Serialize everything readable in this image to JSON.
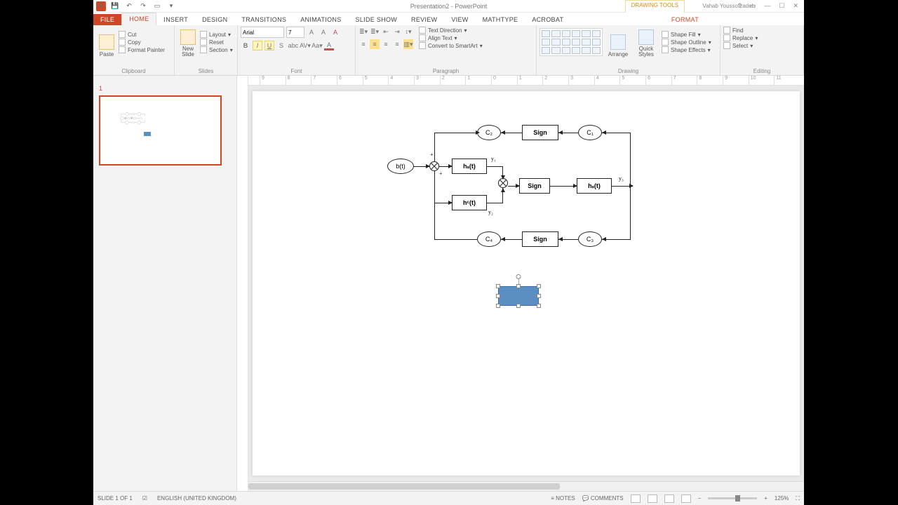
{
  "title": "Presentation2 - PowerPoint",
  "tools_context": "DRAWING TOOLS",
  "user": "Vahab Youssofzadeh",
  "tabs": {
    "file": "FILE",
    "home": "HOME",
    "insert": "INSERT",
    "design": "DESIGN",
    "transitions": "TRANSITIONS",
    "animations": "ANIMATIONS",
    "slideshow": "SLIDE SHOW",
    "review": "REVIEW",
    "view": "VIEW",
    "mathtype": "MathType",
    "acrobat": "ACROBAT",
    "format": "FORMAT"
  },
  "ribbon": {
    "clipboard": {
      "label": "Clipboard",
      "paste": "Paste",
      "cut": "Cut",
      "copy": "Copy",
      "painter": "Format Painter"
    },
    "slides": {
      "label": "Slides",
      "new": "New\nSlide",
      "layout": "Layout",
      "reset": "Reset",
      "section": "Section"
    },
    "font": {
      "label": "Font",
      "name": "Arial",
      "size": "7"
    },
    "paragraph": {
      "label": "Paragraph",
      "textdir": "Text Direction",
      "align": "Align Text",
      "convert": "Convert to SmartArt"
    },
    "drawing": {
      "label": "Drawing",
      "arrange": "Arrange",
      "quick": "Quick\nStyles",
      "fill": "Shape Fill",
      "outline": "Shape Outline",
      "effects": "Shape Effects"
    },
    "editing": {
      "label": "Editing",
      "find": "Find",
      "replace": "Replace",
      "select": "Select"
    }
  },
  "ruler": [
    "9",
    "8",
    "7",
    "6",
    "5",
    "4",
    "3",
    "2",
    "1",
    "0",
    "1",
    "2",
    "3",
    "4",
    "5",
    "6",
    "7",
    "8",
    "9",
    "10",
    "11"
  ],
  "diagram": {
    "C1": "C₁",
    "C2": "C₂",
    "C3": "C₃",
    "C4": "C₄",
    "Sign": "Sign",
    "bt": "b(t)",
    "hs": "hₛ(t)",
    "hc": "hᶜ(t)",
    "hs2": "hₛ(t)",
    "y1": "y₁",
    "y2": "y₂",
    "y3": "y₃"
  },
  "selected": {
    "text": ""
  },
  "status": {
    "slide": "SLIDE 1 OF 1",
    "lang": "ENGLISH (UNITED KINGDOM)",
    "notes": "NOTES",
    "comments": "COMMENTS",
    "zoom": "125%"
  }
}
